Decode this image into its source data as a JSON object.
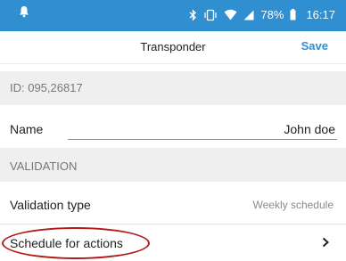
{
  "status_bar": {
    "battery": "78%",
    "time": "16:17"
  },
  "header": {
    "title": "Transponder",
    "save_label": "Save"
  },
  "id_row": {
    "text": "ID: 095,26817"
  },
  "name_row": {
    "label": "Name",
    "value": "John doe"
  },
  "validation_section": {
    "title": "VALIDATION"
  },
  "validation_type_row": {
    "label": "Validation type",
    "value": "Weekly schedule"
  },
  "schedule_row": {
    "label": "Schedule for actions"
  },
  "colors": {
    "status_bar": "#2f8fd0",
    "accent": "#2f8fd0",
    "section_bg": "#efefef",
    "highlight_ellipse": "#b21a1a"
  }
}
